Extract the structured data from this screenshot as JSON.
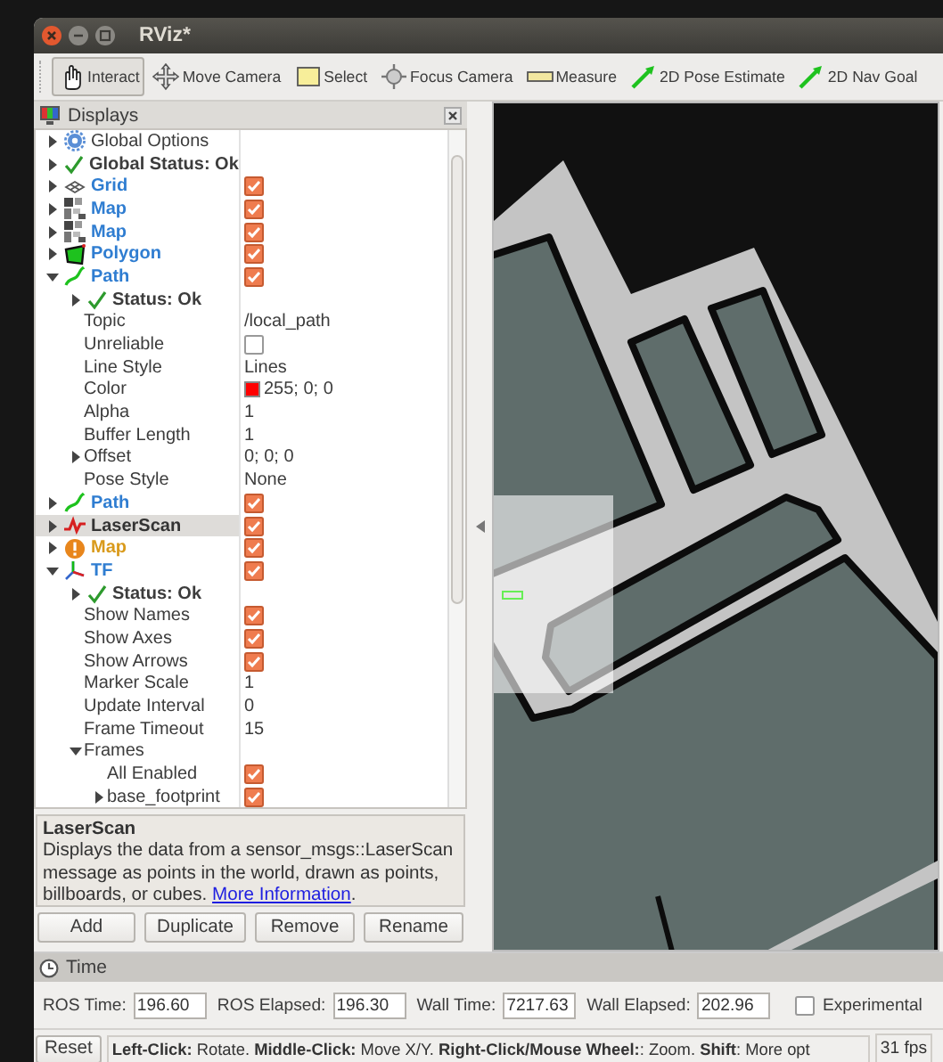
{
  "window": {
    "title": "RViz*"
  },
  "toolbar": [
    {
      "label": "Interact",
      "kind": "interact",
      "selected": true
    },
    {
      "label": "Move Camera",
      "kind": "move",
      "selected": false
    },
    {
      "label": "Select",
      "kind": "select",
      "selected": false
    },
    {
      "label": "Focus Camera",
      "kind": "focus",
      "selected": false
    },
    {
      "label": "Measure",
      "kind": "measure",
      "selected": false
    },
    {
      "label": "2D Pose Estimate",
      "kind": "pose",
      "selected": false
    },
    {
      "label": "2D Nav Goal",
      "kind": "pose",
      "selected": false
    }
  ],
  "displays": {
    "title": "Displays",
    "items": [
      {
        "kind": "options",
        "label": "Global Options",
        "expanded": false,
        "selected": false
      },
      {
        "kind": "status",
        "label": "Global Status: Ok",
        "expanded": false,
        "selected": false
      },
      {
        "kind": "grid",
        "label": "Grid",
        "warning": false,
        "checked": true,
        "expanded": false,
        "selected": false
      },
      {
        "kind": "map",
        "label": "Map",
        "warning": false,
        "checked": true,
        "expanded": false,
        "selected": false
      },
      {
        "kind": "map",
        "label": "Map",
        "warning": false,
        "checked": true,
        "expanded": false,
        "selected": false
      },
      {
        "kind": "polygon",
        "label": "Polygon",
        "warning": false,
        "checked": true,
        "expanded": false,
        "selected": false
      },
      {
        "kind": "path",
        "label": "Path",
        "warning": false,
        "checked": true,
        "expanded": true,
        "selected": false,
        "children": [
          {
            "kind": "status",
            "label": "Status: Ok",
            "expanded": false,
            "selected": false
          },
          {
            "kind": "property",
            "label": "Topic",
            "value": "/local_path",
            "selected": false
          },
          {
            "kind": "property",
            "label": "Unreliable",
            "checked": false,
            "selected": false
          },
          {
            "kind": "property",
            "label": "Line Style",
            "value": "Lines",
            "selected": false
          },
          {
            "kind": "property",
            "label": "Color",
            "value": "255; 0; 0",
            "color": "#ff0000",
            "selected": false
          },
          {
            "kind": "property",
            "label": "Alpha",
            "value": "1",
            "selected": false
          },
          {
            "kind": "property",
            "label": "Buffer Length",
            "value": "1",
            "selected": false
          },
          {
            "kind": "property",
            "label": "Offset",
            "value": "0; 0; 0",
            "expanded": false,
            "selected": false
          },
          {
            "kind": "property",
            "label": "Pose Style",
            "value": "None",
            "selected": false
          }
        ]
      },
      {
        "kind": "path",
        "label": "Path",
        "warning": false,
        "checked": true,
        "expanded": false,
        "selected": false
      },
      {
        "kind": "laserscan",
        "label": "LaserScan",
        "warning": false,
        "checked": true,
        "expanded": false,
        "selected": true
      },
      {
        "kind": "map",
        "label": "Map",
        "warning": true,
        "checked": true,
        "expanded": false,
        "selected": false
      },
      {
        "kind": "tf",
        "label": "TF",
        "warning": false,
        "checked": true,
        "expanded": true,
        "selected": false,
        "children": [
          {
            "kind": "status",
            "label": "Status: Ok",
            "expanded": false,
            "selected": false
          },
          {
            "kind": "property",
            "label": "Show Names",
            "checked": true,
            "selected": false
          },
          {
            "kind": "property",
            "label": "Show Axes",
            "checked": true,
            "selected": false
          },
          {
            "kind": "property",
            "label": "Show Arrows",
            "checked": true,
            "selected": false
          },
          {
            "kind": "property",
            "label": "Marker Scale",
            "value": "1",
            "selected": false
          },
          {
            "kind": "property",
            "label": "Update Interval",
            "value": "0",
            "selected": false
          },
          {
            "kind": "property",
            "label": "Frame Timeout",
            "value": "15",
            "selected": false
          },
          {
            "kind": "property",
            "label": "Frames",
            "expanded": true,
            "selected": false,
            "children": [
              {
                "kind": "property",
                "label": "All Enabled",
                "checked": true,
                "selected": false
              },
              {
                "kind": "property",
                "label": "base_footprint",
                "checked": true,
                "expanded": false,
                "selected": false
              }
            ]
          }
        ]
      }
    ]
  },
  "description": {
    "title": "LaserScan",
    "text": "Displays the data from a sensor_msgs::LaserScan message as points in the world, drawn as points, billboards, or cubes.",
    "link": "More Information",
    "suffix": "."
  },
  "panel_buttons": [
    "Add",
    "Duplicate",
    "Remove",
    "Rename"
  ],
  "time": {
    "title": "Time",
    "fields": [
      {
        "label": "ROS Time:",
        "value": "196.60"
      },
      {
        "label": "ROS Elapsed:",
        "value": "196.30"
      },
      {
        "label": "Wall Time:",
        "value": "7217.63"
      },
      {
        "label": "Wall Elapsed:",
        "value": "202.96"
      }
    ],
    "experimental": {
      "label": "Experimental",
      "checked": false
    }
  },
  "status_bar": {
    "button": "Reset",
    "help": "**Left-Click:** Rotate. **Middle-Click:** Move X/Y. **Right-Click/Mouse Wheel:**: Zoom. **Shift**: More opt",
    "fps": "31 fps"
  }
}
